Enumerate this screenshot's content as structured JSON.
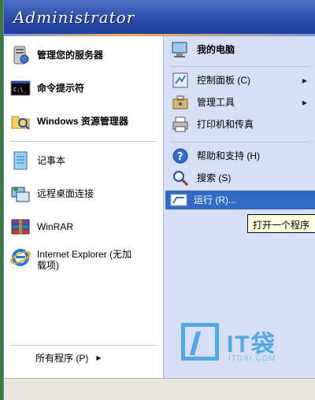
{
  "header": {
    "user_name": "Administrator"
  },
  "left_pinned": [
    {
      "label": "管理您的服务器",
      "icon": "server-manager-icon"
    },
    {
      "label": "命令提示符",
      "icon": "command-prompt-icon"
    },
    {
      "label": "Windows 资源管理器",
      "icon": "explorer-folder-icon"
    }
  ],
  "left_recent": [
    {
      "label": "记事本",
      "icon": "notepad-icon"
    },
    {
      "label": "远程桌面连接",
      "icon": "remote-desktop-icon"
    },
    {
      "label": "WinRAR",
      "icon": "winrar-icon"
    },
    {
      "label": "Internet Explorer (无加",
      "label2": "载项)",
      "icon": "internet-explorer-icon"
    }
  ],
  "all_programs": {
    "label": "所有程序 (P)",
    "arrow": "▶"
  },
  "right_items": [
    {
      "label": "我的电脑",
      "icon": "my-computer-icon"
    },
    {
      "label": "控制面板 (C)",
      "icon": "control-panel-icon",
      "arrow": "▶"
    },
    {
      "label": "管理工具",
      "icon": "admin-tools-icon",
      "arrow": "▶"
    },
    {
      "label": "打印机和传真",
      "icon": "printer-icon"
    },
    {
      "label": "帮助和支持 (H)",
      "icon": "help-icon"
    },
    {
      "label": "搜索 (S)",
      "icon": "search-icon"
    },
    {
      "label": "运行 (R)...",
      "icon": "run-icon"
    }
  ],
  "tooltip": {
    "text": "打开一个程序"
  },
  "watermark": {
    "brand": "IT袋",
    "site": "ITDAI.COM"
  },
  "colors": {
    "header": "#2a4aa8",
    "selection": "#316ac5",
    "right_panel": "#d6dff5",
    "tooltip_bg": "#ffffe1",
    "watermark": "#4fa9e6"
  }
}
